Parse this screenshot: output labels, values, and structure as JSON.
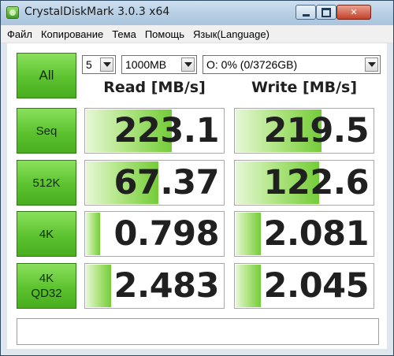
{
  "window": {
    "title": "CrystalDiskMark 3.0.3 x64"
  },
  "caption_buttons": {
    "minimize": "",
    "maximize": "",
    "close": "✕"
  },
  "menu": [
    "Файл",
    "Копирование",
    "Тема",
    "Помощь",
    "Язык(Language)"
  ],
  "controls": {
    "all_label": "All",
    "count": "5",
    "size": "1000MB",
    "drive": "O: 0% (0/3726GB)"
  },
  "columns": {
    "read": "Read [MB/s]",
    "write": "Write [MB/s]"
  },
  "rows": [
    {
      "label": "Seq",
      "read": "223.1",
      "write": "219.5",
      "read_fill": 0.62,
      "write_fill": 0.62
    },
    {
      "label": "512K",
      "read": "67.37",
      "write": "122.6",
      "read_fill": 0.52,
      "write_fill": 0.6
    },
    {
      "label": "4K",
      "read": "0.798",
      "write": "2.081",
      "read_fill": 0.1,
      "write_fill": 0.18
    },
    {
      "label": "4K\nQD32",
      "read": "2.483",
      "write": "2.045",
      "read_fill": 0.18,
      "write_fill": 0.18
    }
  ],
  "status": ""
}
